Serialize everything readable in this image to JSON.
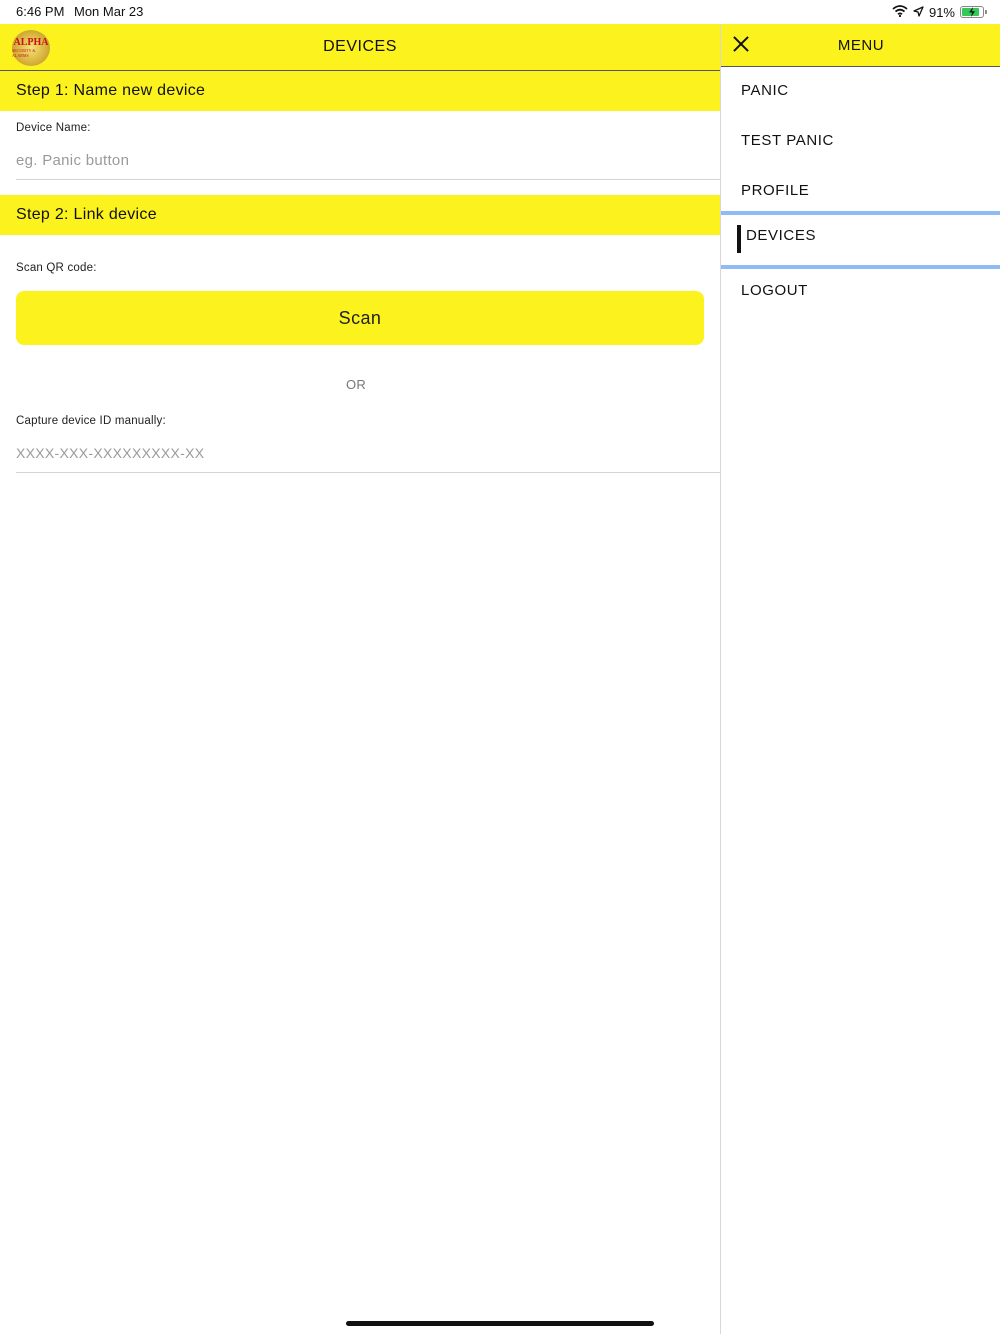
{
  "status_bar": {
    "time": "6:46 PM",
    "date": "Mon Mar 23",
    "battery": "91%",
    "battery_level": 0.91,
    "icons": [
      "wifi-icon",
      "location-arrow-icon",
      "battery-charging-icon"
    ]
  },
  "header": {
    "title": "DEVICES",
    "logo_text": "ALPHA",
    "logo_subtext": "SECURITY & ALARMS"
  },
  "step1": {
    "title": "Step 1: Name new device",
    "name_label": "Device Name:",
    "name_placeholder": "eg. Panic button",
    "name_value": ""
  },
  "step2": {
    "title": "Step 2: Link device",
    "scan_label": "Scan QR code:",
    "scan_button": "Scan",
    "or_text": "OR",
    "manual_label": "Capture device ID manually:",
    "manual_placeholder": "XXXX-XXX-XXXXXXXXX-XX",
    "manual_value": ""
  },
  "menu": {
    "title": "MENU",
    "close_icon": "close-icon",
    "items": [
      {
        "label": "PANIC",
        "active": false
      },
      {
        "label": "TEST PANIC",
        "active": false
      },
      {
        "label": "PROFILE",
        "active": false
      },
      {
        "label": "DEVICES",
        "active": true
      },
      {
        "label": "LOGOUT",
        "active": false
      }
    ]
  },
  "colors": {
    "brand_yellow": "#fcf21e",
    "active_accent": "#8fbcf2",
    "battery_green": "#34c759",
    "logo_red": "#c8121b"
  }
}
